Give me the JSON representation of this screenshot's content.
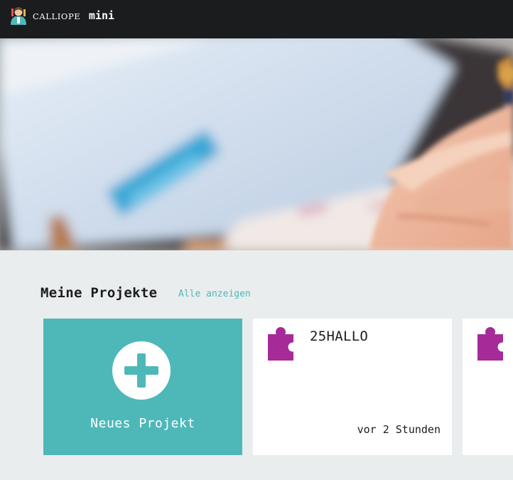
{
  "header": {
    "brand_calliope": "CALLIOPE",
    "brand_mini": "mini",
    "logo_icon": "calliope-person-icon"
  },
  "hero": {
    "image": "hero-photo-hand-tablet"
  },
  "projects": {
    "heading": "Meine Projekte",
    "show_all": "Alle anzeigen",
    "new_project_label": "Neues Projekt",
    "items": [
      {
        "title": "25HALLO",
        "updated": "vor 2 Stunden",
        "icon": "puzzle-icon"
      },
      {
        "title": "",
        "updated": "",
        "icon": "puzzle-icon"
      }
    ]
  },
  "colors": {
    "accent": "#4eb8b9",
    "puzzle": "#a62a98",
    "topbar": "#1b1c1d",
    "background": "#eaedee"
  }
}
